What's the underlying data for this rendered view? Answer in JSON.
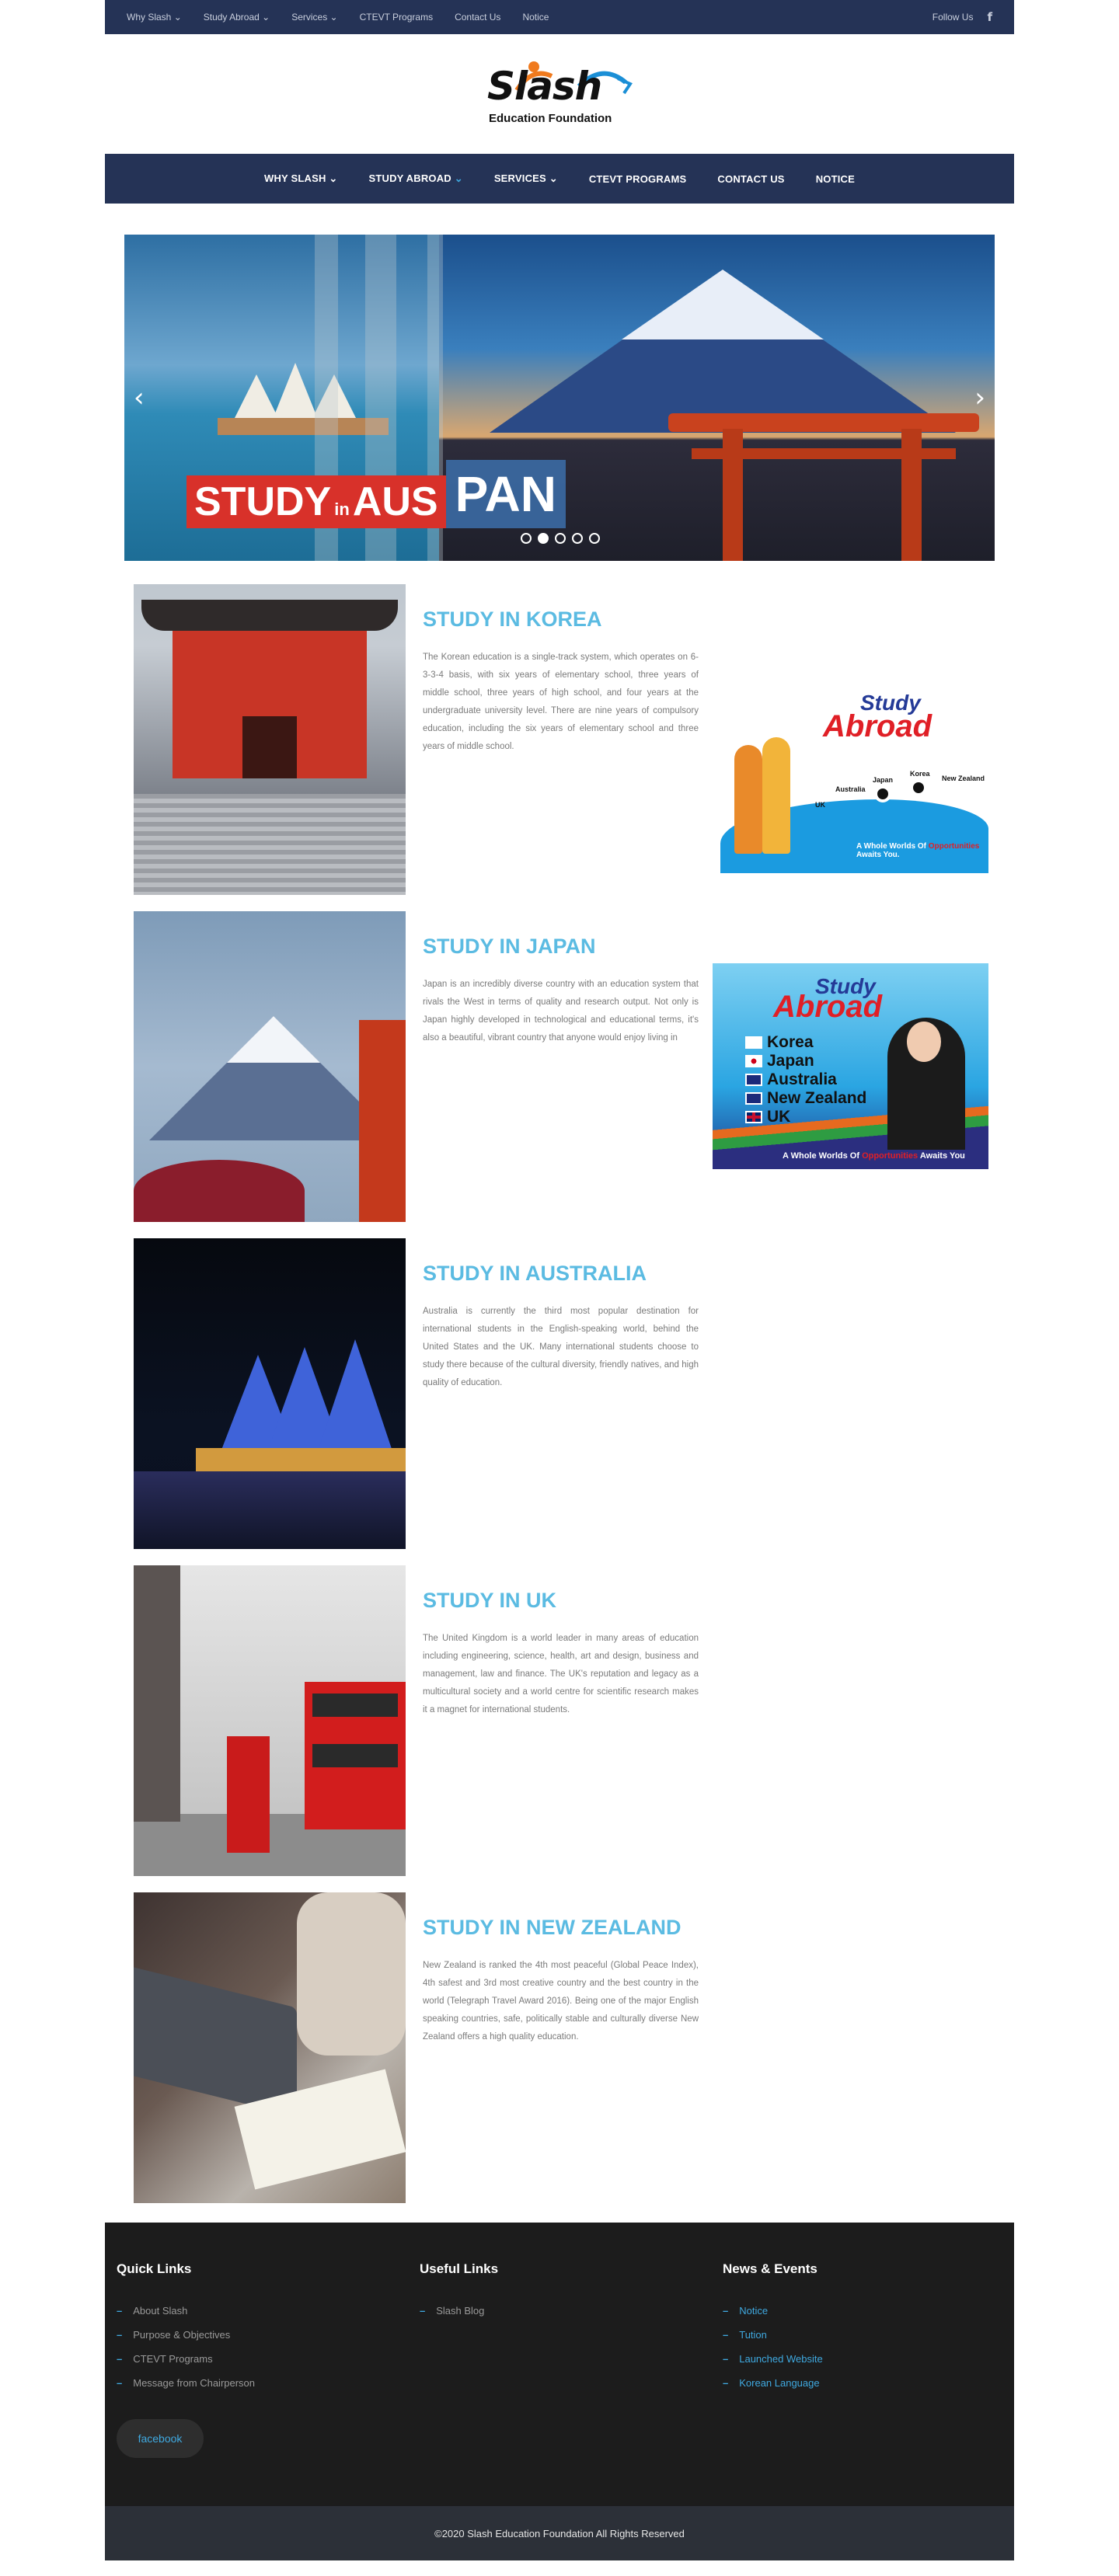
{
  "topbar": {
    "links": [
      "Why Slash",
      "Study Abroad",
      "Services",
      "CTEVT Programs",
      "Contact Us",
      "Notice"
    ],
    "follow_label": "Follow Us",
    "facebook_glyph": "f"
  },
  "logo": {
    "word": "Slash",
    "subtitle": "Education Foundation"
  },
  "nav": {
    "items": [
      "WHY SLASH",
      "STUDY ABROAD",
      "SERVICES",
      "CTEVT PROGRAMS",
      "CONTACT US",
      "NOTICE"
    ],
    "active_index": 1
  },
  "slider": {
    "caption_study": "STUDY",
    "caption_in": "in",
    "caption_aus": "AUS",
    "caption_pan": "PAN",
    "dot_count": 5,
    "active_dot": 1
  },
  "studies": [
    {
      "title": "STUDY IN KOREA",
      "body": "The Korean education is a single-track system, which operates on 6-3-3-4 basis, with six years of elementary school, three years of middle school, three years of high school, and four years at the undergraduate university level. There are nine years of compulsory education, including the six years of elementary school and three years of middle school."
    },
    {
      "title": "STUDY IN JAPAN",
      "body": "Japan is an incredibly diverse country with an education system that rivals the West in terms of quality and research output. Not only is Japan highly developed in technological and educational terms, it's also a beautiful, vibrant country that anyone would enjoy living in"
    },
    {
      "title": "STUDY IN AUSTRALIA",
      "body": "Australia is currently the third most popular destination for international students in the English-speaking world, behind the United States and the UK. Many international students choose to study there because of the cultural diversity, friendly natives, and high quality of education."
    },
    {
      "title": "STUDY IN UK",
      "body": "The United Kingdom is a world leader in many areas of education including engineering, science, health, art and design, business and management, law and finance. The UK's reputation and legacy as a multicultural society and a world centre for scientific research makes it a magnet for international students."
    },
    {
      "title": "STUDY IN NEW ZEALAND",
      "body": "New Zealand is ranked the 4th most peaceful (Global Peace Index), 4th safest and 3rd most creative country and the best country in the world (Telegraph Travel Award 2016). Being one of the major English speaking countries, safe, politically stable and culturally diverse New Zealand offers a high quality education."
    }
  ],
  "promo1": {
    "title1": "Study",
    "title2": "Abroad",
    "destinations": [
      "UK",
      "Australia",
      "Japan",
      "Korea",
      "New Zealand"
    ],
    "tag_prefix": "A Whole Worlds Of",
    "tag_highlight": "Opportunities",
    "tag_suffix": "Awaits You."
  },
  "promo2": {
    "title1": "Study",
    "title2": "Abroad",
    "countries": [
      "Korea",
      "Japan",
      "Australia",
      "New Zealand",
      "UK"
    ],
    "tag_prefix": "A Whole Worlds Of",
    "tag_highlight": "Opportunities",
    "tag_suffix": "Awaits You"
  },
  "footer": {
    "quick_title": "Quick Links",
    "quick_links": [
      "About Slash",
      "Purpose & Objectives",
      "CTEVT Programs",
      "Message from Chairperson"
    ],
    "useful_title": "Useful Links",
    "useful_links": [
      "Slash Blog"
    ],
    "news_title": "News & Events",
    "news_links": [
      "Notice",
      "Tution",
      "Launched Website",
      "Korean Language"
    ],
    "facebook_label": "facebook",
    "copyright": "©2020 Slash Education Foundation All Rights Reserved"
  },
  "colors": {
    "navy": "#253356",
    "accent_blue": "#3fa9e0",
    "heading_blue": "#5bbbe2",
    "footer_bg": "#1c1c1c"
  }
}
